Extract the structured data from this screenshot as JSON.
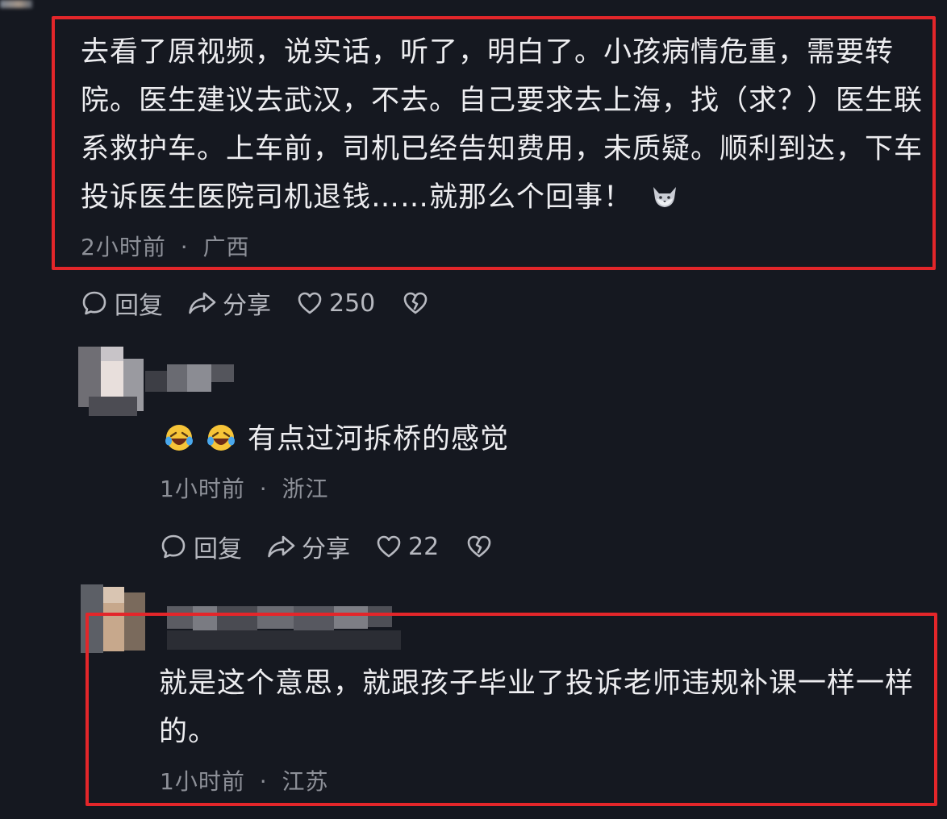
{
  "comments": [
    {
      "text": "去看了原视频，说实话，听了，明白了。小孩病情危重，需要转院。医生建议去武汉，不去。自己要求去上海，找（求？）医生联系救护车。上车前，司机已经告知费用，未质疑。顺利到达，下车投诉医生医院司机退钱……就那么个回事！",
      "time": "2小时前",
      "location": "广西",
      "reply_label": "回复",
      "share_label": "分享",
      "likes": "250",
      "highlighted": true
    },
    {
      "text": "有点过河拆桥的感觉",
      "time": "1小时前",
      "location": "浙江",
      "reply_label": "回复",
      "share_label": "分享",
      "likes": "22",
      "highlighted": false
    },
    {
      "text": "就是这个意思，就跟孩子毕业了投诉老师违规补课一样一样的。",
      "time": "1小时前",
      "location": "江苏",
      "highlighted": true
    }
  ],
  "meta_separator": "·",
  "colors": {
    "background": "#151820",
    "highlight_border": "#e3262a",
    "text": "#ededf0",
    "muted": "#8d9098"
  }
}
